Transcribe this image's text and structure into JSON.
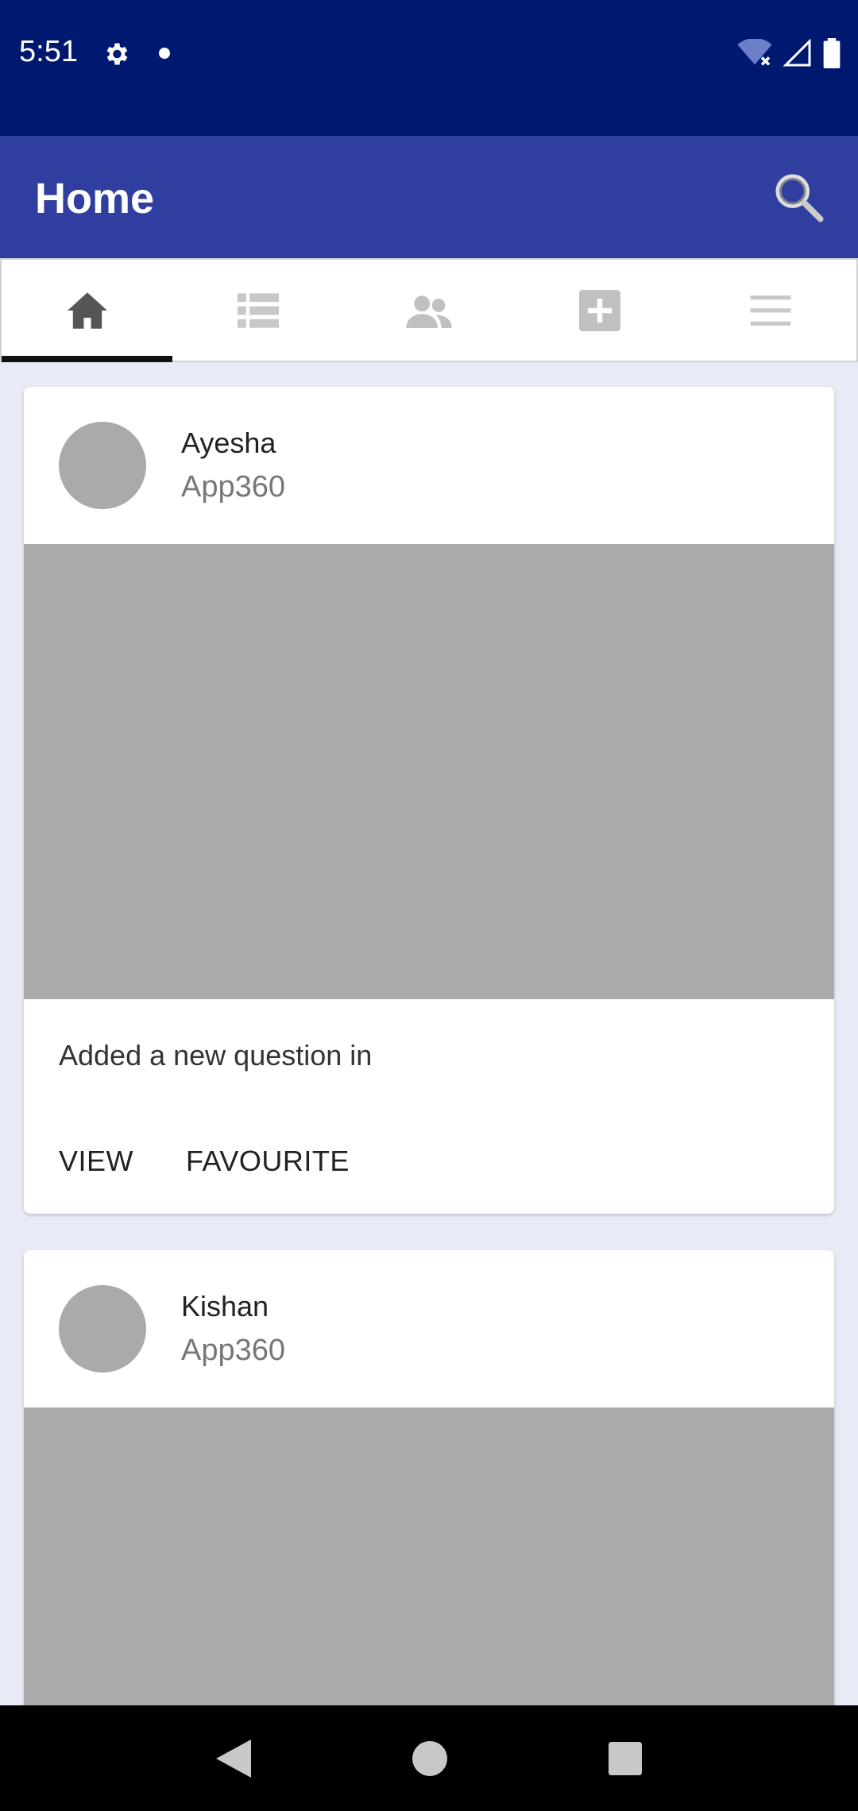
{
  "status_bar": {
    "time": "5:51"
  },
  "app_bar": {
    "title": "Home"
  },
  "tabs": [
    {
      "icon": "home-icon",
      "active": true
    },
    {
      "icon": "list-icon",
      "active": false
    },
    {
      "icon": "people-icon",
      "active": false
    },
    {
      "icon": "add-box-icon",
      "active": false
    },
    {
      "icon": "menu-icon",
      "active": false
    }
  ],
  "feed": {
    "cards": [
      {
        "author": "Ayesha",
        "subtitle": "App360",
        "text": "Added a new question in",
        "actions": {
          "view": "VIEW",
          "favourite": "FAVOURITE"
        }
      },
      {
        "author": "Kishan",
        "subtitle": "App360"
      }
    ]
  },
  "colors": {
    "status_bar": "#001970",
    "app_bar": "#303f9f",
    "background": "#e8eaf6",
    "placeholder": "#aaaaaa"
  }
}
